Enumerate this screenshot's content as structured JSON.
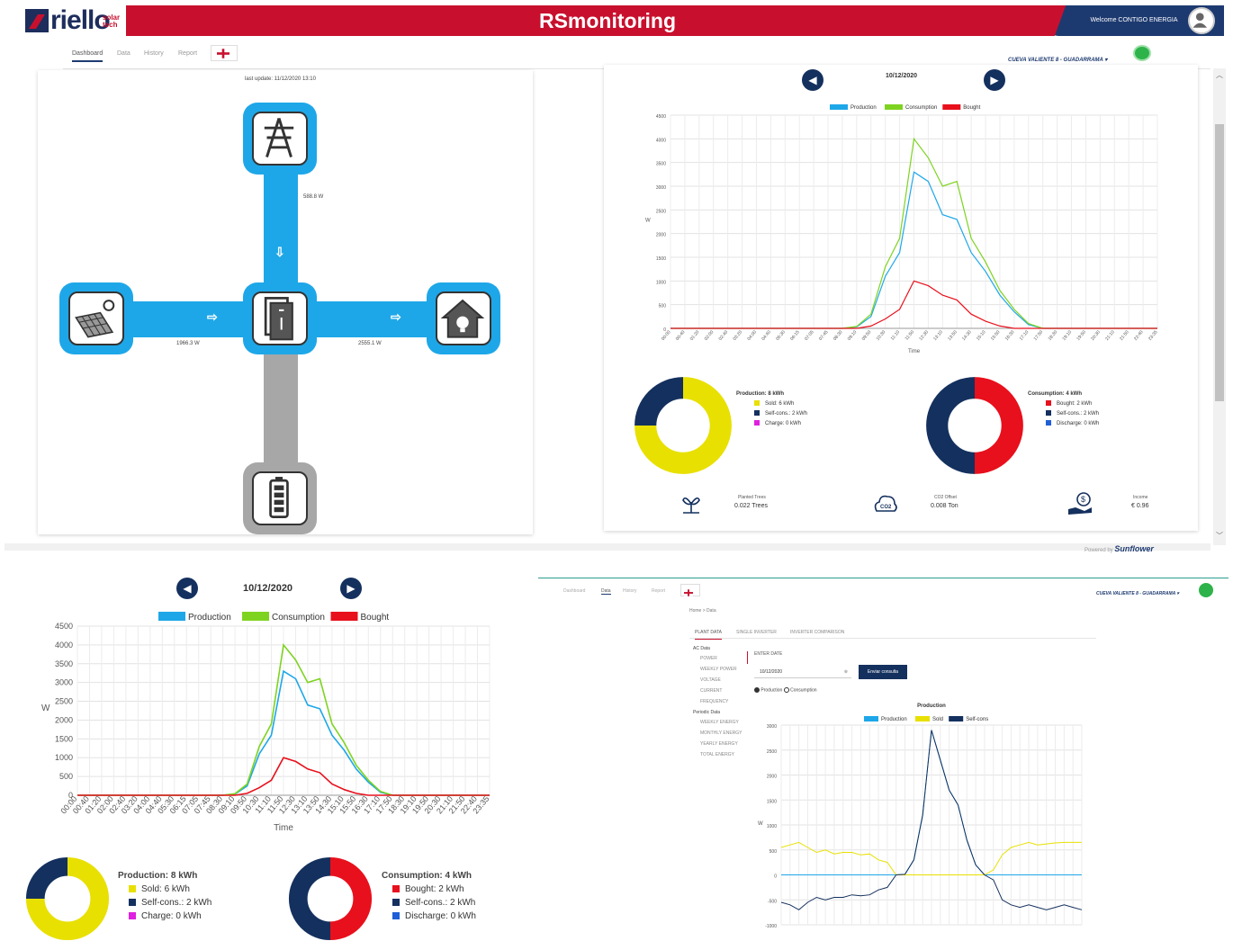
{
  "header": {
    "logo_text": "riello",
    "logo_sub": "solar tech",
    "app_title": "RSmonitoring",
    "welcome": "Welcome CONTIGO ENERGIA"
  },
  "nav": {
    "tabs": [
      "Dashboard",
      "Data",
      "History",
      "Report"
    ],
    "plant": "CUEVA VALIENTE 8 - GUADARRAMA ▾"
  },
  "flow": {
    "last_update": "last update: 11/12/2020 13:10",
    "grid_power": "588.8 W",
    "solar_power": "1966.3 W",
    "house_power": "2555.1 W"
  },
  "chart_panel": {
    "date": "10/12/2020",
    "ylabel": "W",
    "xlabel": "Time",
    "legend": [
      "Production",
      "Consumption",
      "Bought"
    ]
  },
  "donuts": {
    "production": {
      "title": "Production: 8 kWh",
      "items": [
        "Sold: 6 kWh",
        "Self-cons.: 2 kWh",
        "Charge: 0 kWh"
      ]
    },
    "consumption": {
      "title": "Consumption: 4 kWh",
      "items": [
        "Bought: 2 kWh",
        "Self-cons.: 2 kWh",
        "Discharge: 0 kWh"
      ]
    }
  },
  "stats": {
    "trees_label": "Planted Trees",
    "trees_value": "0.022 Trees",
    "co2_label": "CO2 Offset",
    "co2_value": "0.008 Ton",
    "income_label": "Income",
    "income_value": "€ 0.96"
  },
  "powered": "Powered by",
  "powered_brand": "Sunflower",
  "data_page": {
    "breadcrumb": "Home  >  Data",
    "subtabs": [
      "PLANT DATA",
      "SINGLE INVERTER",
      "INVERTER COMPARISON"
    ],
    "side_ac": "AC Data",
    "side_items": [
      "POWER",
      "WEEKLY POWER",
      "VOLTAGE",
      "CURRENT",
      "FREQUENCY"
    ],
    "side_periodic": "Periodic Data",
    "side_items2": [
      "WEEKLY ENERGY",
      "MONTHLY ENERGY",
      "YEARLY ENERGY",
      "TOTAL ENERGY"
    ],
    "enter_date": "ENTER DATE",
    "date_value": "10/12/2020",
    "submit": "Enviar consulta",
    "radio1": "Production",
    "radio2": "Consumption",
    "chart_title": "Production",
    "legend": [
      "Production",
      "Sold",
      "Self-cons"
    ],
    "ylabel": "W"
  },
  "chart_data": [
    {
      "type": "line",
      "title": "",
      "xlabel": "Time",
      "ylabel": "W",
      "ylim": [
        0,
        4500
      ],
      "x": [
        "00:00",
        "00:40",
        "01:20",
        "02:00",
        "02:40",
        "03:20",
        "04:00",
        "04:40",
        "05:30",
        "06:15",
        "07:05",
        "07:45",
        "08:30",
        "09:10",
        "09:50",
        "10:30",
        "11:10",
        "11:50",
        "12:30",
        "13:10",
        "13:50",
        "14:30",
        "15:10",
        "15:50",
        "16:30",
        "17:10",
        "17:50",
        "18:30",
        "19:10",
        "19:50",
        "20:30",
        "21:10",
        "21:50",
        "22:40",
        "23:35"
      ],
      "series": [
        {
          "name": "Production",
          "values": [
            0,
            0,
            0,
            0,
            0,
            0,
            0,
            0,
            0,
            0,
            0,
            0,
            0,
            30,
            250,
            1100,
            1600,
            3300,
            3100,
            2400,
            2300,
            1600,
            1200,
            700,
            350,
            80,
            0,
            0,
            0,
            0,
            0,
            0,
            0,
            0,
            0
          ]
        },
        {
          "name": "Consumption",
          "values": [
            0,
            0,
            0,
            0,
            0,
            0,
            0,
            0,
            0,
            0,
            0,
            0,
            0,
            40,
            300,
            1300,
            1900,
            4000,
            3600,
            3000,
            3100,
            1900,
            1400,
            800,
            400,
            100,
            0,
            0,
            0,
            0,
            0,
            0,
            0,
            0,
            0
          ]
        },
        {
          "name": "Bought",
          "values": [
            0,
            0,
            0,
            0,
            0,
            0,
            0,
            0,
            0,
            0,
            0,
            0,
            0,
            0,
            50,
            200,
            400,
            1000,
            900,
            700,
            600,
            300,
            150,
            50,
            0,
            0,
            0,
            0,
            0,
            0,
            0,
            0,
            0,
            0,
            0
          ]
        }
      ]
    },
    {
      "type": "pie",
      "title": "Production: 8 kWh",
      "categories": [
        "Sold",
        "Self-cons.",
        "Charge"
      ],
      "values": [
        6,
        2,
        0
      ]
    },
    {
      "type": "pie",
      "title": "Consumption: 4 kWh",
      "categories": [
        "Bought",
        "Self-cons.",
        "Discharge"
      ],
      "values": [
        2,
        2,
        0
      ]
    },
    {
      "type": "line",
      "title": "Production",
      "ylabel": "W",
      "ylim": [
        -1000,
        3000
      ],
      "yticks": [
        3000,
        2500,
        2000,
        1500,
        1000,
        500,
        0,
        -500,
        -1000
      ],
      "series": [
        {
          "name": "Production",
          "values": [
            0,
            0,
            0,
            0,
            0,
            0,
            0,
            0,
            0,
            0,
            0,
            0,
            0,
            0,
            10,
            300,
            1200,
            2900,
            2300,
            1700,
            1400,
            700,
            200,
            0,
            0,
            0,
            0,
            0,
            0,
            0,
            0,
            0,
            0,
            0,
            0
          ]
        },
        {
          "name": "Sold",
          "values": [
            550,
            600,
            650,
            550,
            450,
            500,
            420,
            450,
            450,
            400,
            420,
            300,
            250,
            0,
            0,
            0,
            0,
            0,
            0,
            0,
            0,
            0,
            0,
            0,
            100,
            400,
            550,
            600,
            650,
            600,
            620,
            640,
            650,
            650,
            650
          ]
        },
        {
          "name": "Self-cons",
          "values": [
            -550,
            -600,
            -700,
            -550,
            -450,
            -500,
            -450,
            -450,
            -400,
            -420,
            -400,
            -300,
            -250,
            0,
            10,
            300,
            1200,
            2900,
            2300,
            1700,
            1400,
            700,
            200,
            0,
            -100,
            -500,
            -600,
            -650,
            -600,
            -650,
            -700,
            -650,
            -600,
            -650,
            -700
          ]
        }
      ]
    }
  ],
  "colors": {
    "production": "#1ea7e8",
    "consumption": "#7ed321",
    "bought": "#e8101c",
    "sold": "#e8e000",
    "selfcons": "#14305e",
    "charge": "#e020e0",
    "discharge": "#1e5fd8"
  }
}
